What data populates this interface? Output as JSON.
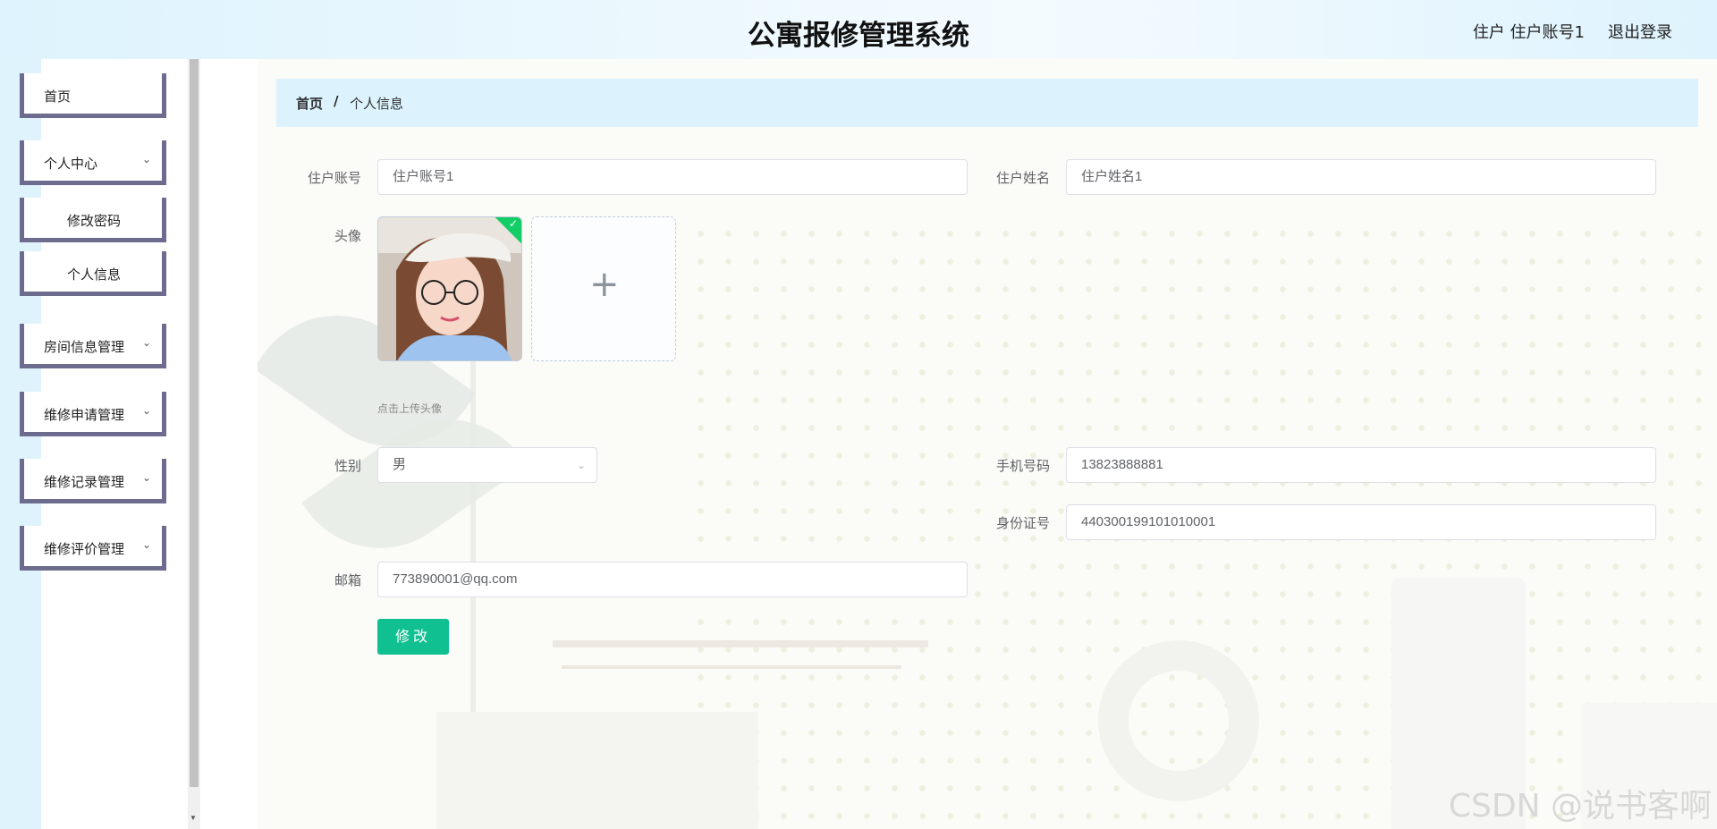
{
  "header": {
    "title": "公寓报修管理系统",
    "user": "住户 住户账号1",
    "logout": "退出登录"
  },
  "sidebar": {
    "items": [
      {
        "label": "首页"
      },
      {
        "label": "个人中心",
        "icon": "chevron-down-icon"
      },
      {
        "label": "修改密码"
      },
      {
        "label": "个人信息"
      },
      {
        "label": "房间信息管理",
        "icon": "chevron-down-icon"
      },
      {
        "label": "维修申请管理",
        "icon": "chevron-down-icon"
      },
      {
        "label": "维修记录管理",
        "icon": "chevron-down-icon"
      },
      {
        "label": "维修评价管理",
        "icon": "chevron-down-icon"
      }
    ]
  },
  "breadcrumb": {
    "home": "首页",
    "separator": "/",
    "current": "个人信息"
  },
  "form": {
    "account_label": "住户账号",
    "account_value": "住户账号1",
    "name_label": "住户姓名",
    "name_value": "住户姓名1",
    "avatar_label": "头像",
    "avatar_tip": "点击上传头像",
    "gender_label": "性别",
    "gender_value": "男",
    "phone_label": "手机号码",
    "phone_value": "13823888881",
    "idcard_label": "身份证号",
    "idcard_value": "440300199101010001",
    "email_label": "邮箱",
    "email_value": "773890001@qq.com",
    "submit": "修改"
  },
  "watermark": "CSDN @说书客啊",
  "colors": {
    "accent": "#10c091",
    "menu_border": "#6d6b8e",
    "breadcrumb_bg": "#dcf2fd"
  }
}
